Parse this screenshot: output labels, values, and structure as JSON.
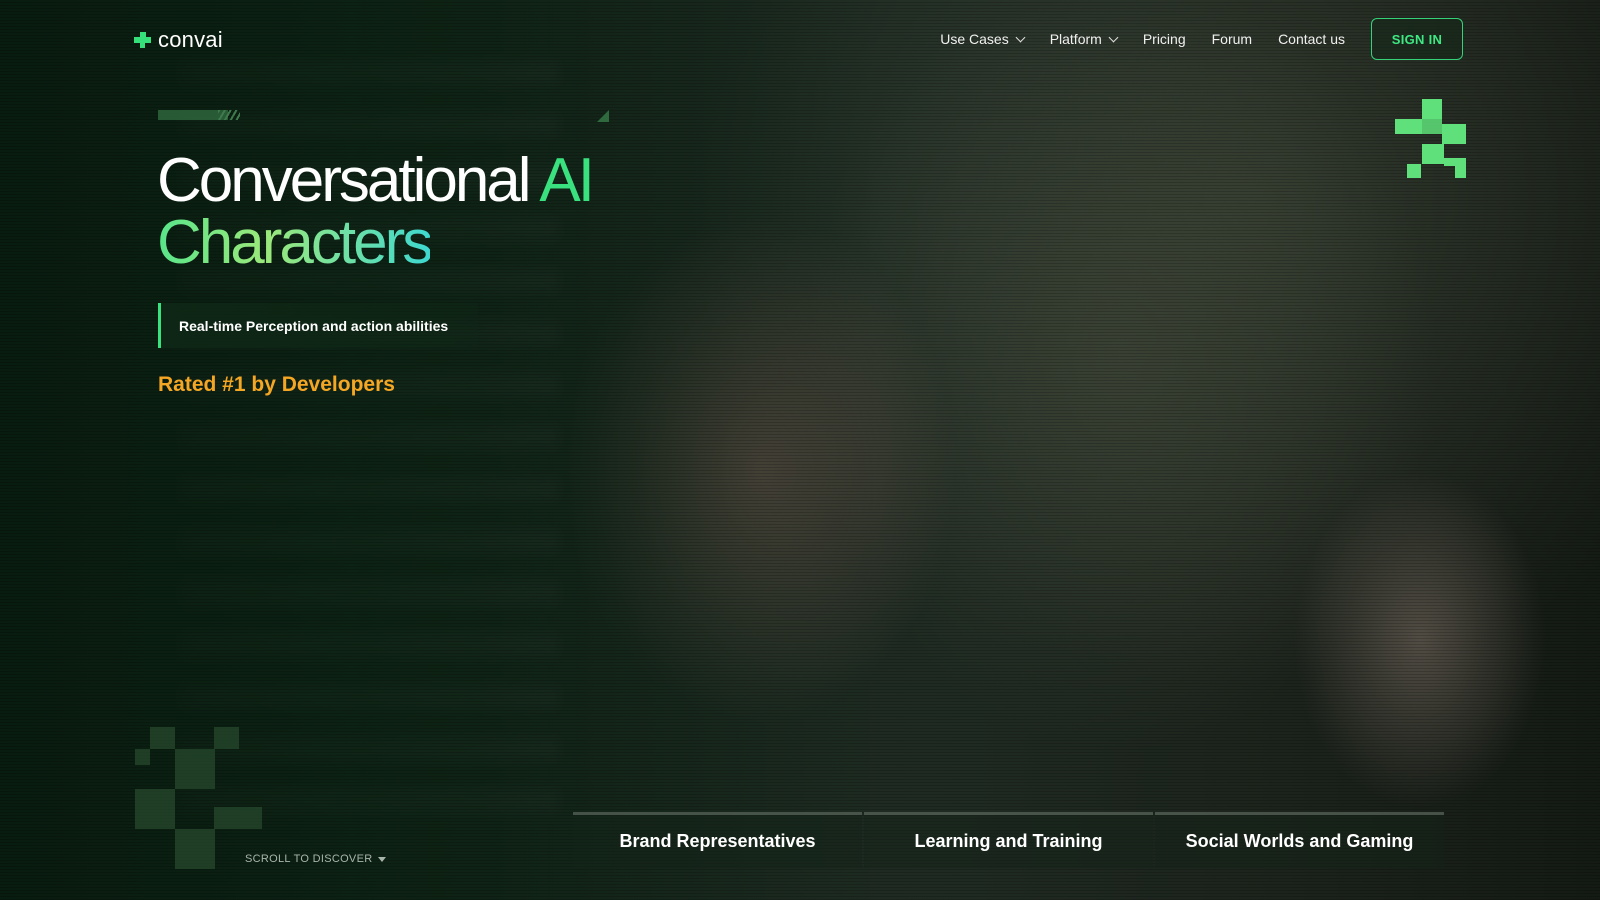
{
  "brand": {
    "name": "convai",
    "accent": "#3ae27f",
    "highlight": "#f5a623"
  },
  "nav": {
    "items": [
      {
        "label": "Use Cases",
        "dropdown": true
      },
      {
        "label": "Platform",
        "dropdown": true
      },
      {
        "label": "Pricing",
        "dropdown": false
      },
      {
        "label": "Forum",
        "dropdown": false
      },
      {
        "label": "Contact us",
        "dropdown": false
      }
    ],
    "signin_label": "SIGN IN"
  },
  "hero": {
    "headline_part1": "Conversational ",
    "headline_accent": "AI",
    "headline_line2": "Characters",
    "tagline": "Real-time Perception and action abilities",
    "rated": "Rated #1 by Developers"
  },
  "scroll_hint": "SCROLL TO DISCOVER",
  "tabs": [
    {
      "label": "Brand Representatives"
    },
    {
      "label": "Learning and Training"
    },
    {
      "label": "Social Worlds and Gaming"
    }
  ],
  "icons": {
    "logo": "convai-logo-icon",
    "dropdown": "chevron-down-icon",
    "scroll": "caret-down-icon"
  }
}
